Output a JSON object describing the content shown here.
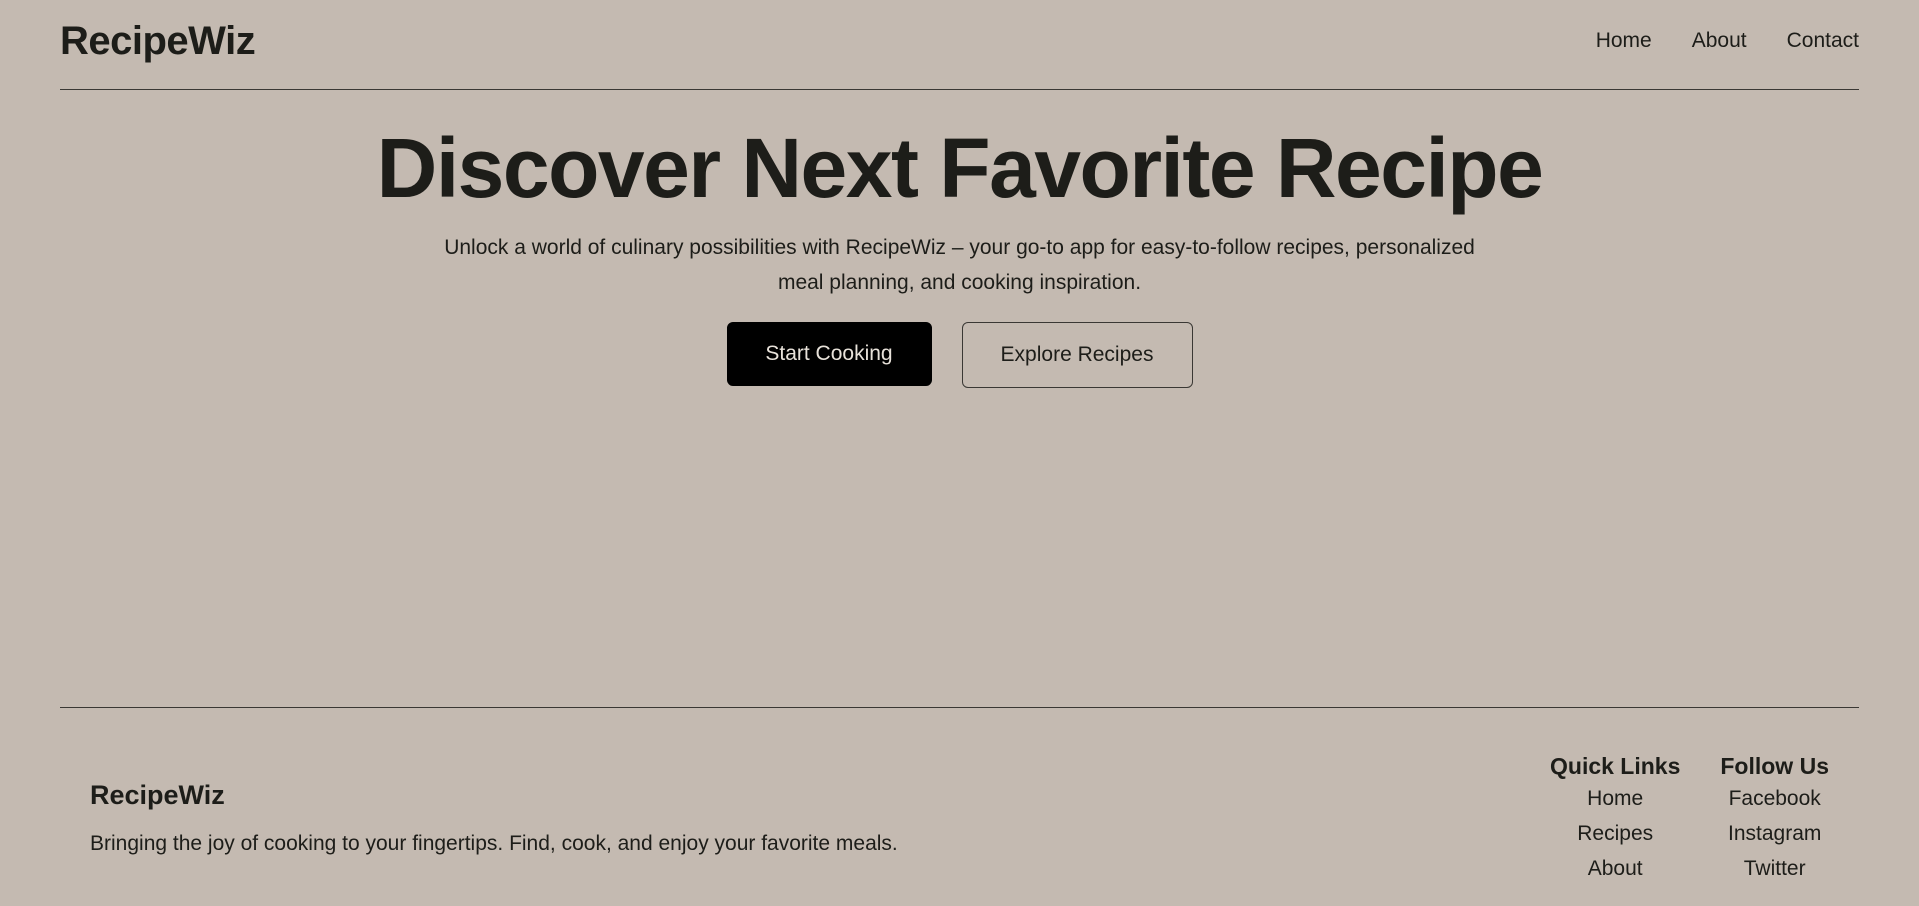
{
  "header": {
    "brand": "RecipeWiz",
    "nav": [
      {
        "label": "Home"
      },
      {
        "label": "About"
      },
      {
        "label": "Contact"
      }
    ]
  },
  "hero": {
    "title": "Discover Next Favorite Recipe",
    "subtitle": "Unlock a world of culinary possibilities with RecipeWiz – your go-to app for easy-to-follow recipes, personalized meal planning, and cooking inspiration.",
    "primary_button": "Start Cooking",
    "secondary_button": "Explore Recipes"
  },
  "footer": {
    "brand": "RecipeWiz",
    "tagline": "Bringing the joy of cooking to your fingertips. Find, cook, and enjoy your favorite meals.",
    "quick_links": {
      "heading": "Quick Links",
      "items": [
        "Home",
        "Recipes",
        "About"
      ]
    },
    "follow_us": {
      "heading": "Follow Us",
      "items": [
        "Facebook",
        "Instagram",
        "Twitter"
      ]
    }
  },
  "colors": {
    "background": "#c4bab1",
    "text": "#1d1d19",
    "primary_button_bg": "#000000"
  }
}
